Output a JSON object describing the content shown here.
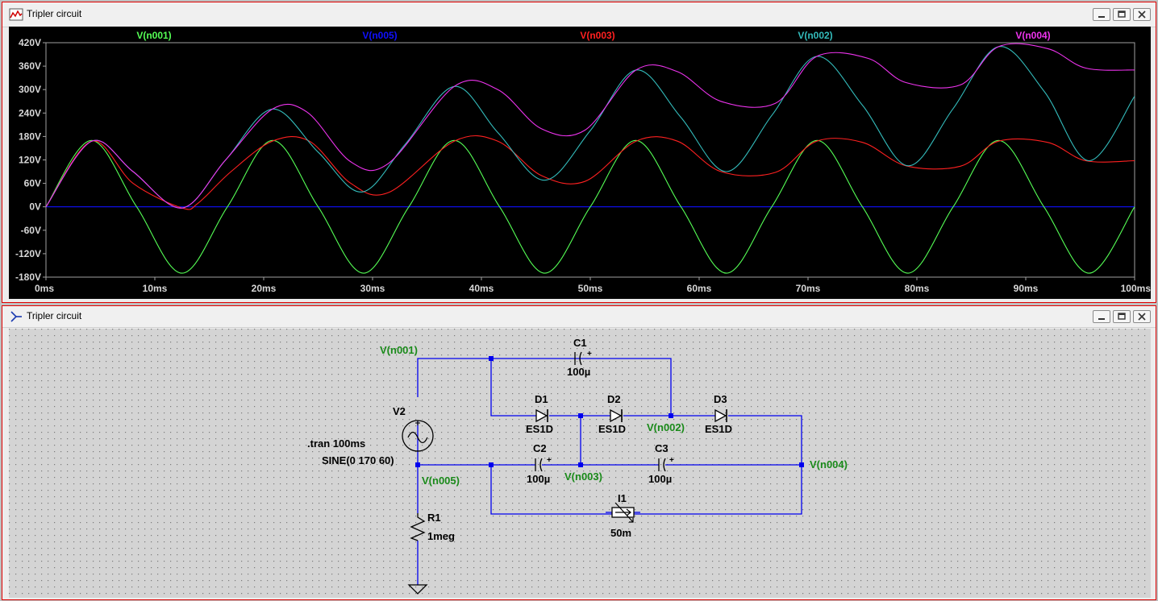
{
  "waveform_window": {
    "title": "Tripler circuit",
    "icon": "waveform-icon",
    "controls": [
      "minimize-icon",
      "restore-icon",
      "close-icon"
    ]
  },
  "schematic_window": {
    "title": "Tripler circuit",
    "icon": "schematic-icon",
    "controls": [
      "minimize-icon",
      "restore-icon",
      "close-icon"
    ]
  },
  "chart_data": {
    "type": "line",
    "xlabel": "",
    "ylabel": "",
    "xlim": [
      0,
      100
    ],
    "ylim": [
      -180,
      420
    ],
    "x_ticks": [
      "0ms",
      "10ms",
      "20ms",
      "30ms",
      "40ms",
      "50ms",
      "60ms",
      "70ms",
      "80ms",
      "90ms",
      "100ms"
    ],
    "y_ticks": [
      "420V",
      "360V",
      "300V",
      "240V",
      "180V",
      "120V",
      "60V",
      "0V",
      "-60V",
      "-120V",
      "-180V"
    ],
    "grid": false,
    "legend": "top",
    "x_unit": "ms",
    "series": [
      {
        "name": "V(n001)",
        "color": "#55ff55",
        "x": [
          0,
          4.17,
          8.33,
          12.5,
          16.67,
          20.83,
          25,
          29.17,
          33.33,
          37.5,
          41.67,
          45.83,
          50,
          54.17,
          58.33,
          62.5,
          66.67,
          70.83,
          75,
          79.17,
          83.33,
          87.5,
          91.67,
          95.83,
          100
        ],
        "y": [
          0,
          170,
          0,
          -170,
          0,
          170,
          0,
          -170,
          0,
          170,
          0,
          -170,
          0,
          170,
          0,
          -170,
          0,
          170,
          0,
          -170,
          0,
          170,
          0,
          -170,
          0
        ]
      },
      {
        "name": "V(n005)",
        "color": "#1010ff",
        "x": [
          0,
          100
        ],
        "y": [
          0,
          0
        ]
      },
      {
        "name": "V(n003)",
        "color": "#ff2020",
        "x": [
          0,
          4.2,
          8,
          12.5,
          14,
          17,
          20.8,
          24.2,
          28,
          31.5,
          37.5,
          41.5,
          45.5,
          49.5,
          54.2,
          58,
          62,
          67,
          70.8,
          75,
          79,
          84,
          87.5,
          92,
          95.5,
          100
        ],
        "y": [
          0,
          168,
          60,
          -3,
          10,
          90,
          168,
          168,
          60,
          37,
          168,
          168,
          80,
          65,
          168,
          168,
          90,
          88,
          168,
          165,
          105,
          104,
          168,
          165,
          118,
          118
        ]
      },
      {
        "name": "V(n002)",
        "color": "#33bbbb",
        "x": [
          0,
          4.2,
          8,
          12.5,
          16.5,
          20.8,
          25,
          29,
          33,
          37.5,
          41.5,
          45.8,
          50,
          54.2,
          58.3,
          62.5,
          66.7,
          70.8,
          75,
          79.2,
          83.3,
          87.5,
          91.7,
          95.8,
          100
        ],
        "y": [
          0,
          168,
          90,
          -3,
          120,
          250,
          140,
          38,
          160,
          308,
          190,
          68,
          195,
          350,
          230,
          90,
          235,
          385,
          260,
          105,
          250,
          410,
          295,
          118,
          283
        ]
      },
      {
        "name": "V(n004)",
        "color": "#ee33ee",
        "x": [
          0,
          4.2,
          8,
          12.5,
          16.5,
          20.8,
          24,
          28,
          31.5,
          37.5,
          41.5,
          45.5,
          49.5,
          54.2,
          58,
          62,
          67,
          70.8,
          75.5,
          79,
          84,
          87.5,
          92,
          95.5,
          100
        ],
        "y": [
          0,
          168,
          90,
          -3,
          120,
          250,
          242,
          115,
          112,
          308,
          300,
          200,
          196,
          350,
          346,
          270,
          265,
          385,
          380,
          318,
          312,
          410,
          405,
          355,
          350
        ]
      }
    ]
  },
  "schematic": {
    "net_labels": {
      "n001": "V(n001)",
      "n002": "V(n002)",
      "n003": "V(n003)",
      "n004": "V(n004)",
      "n005": "V(n005)"
    },
    "components": {
      "C1": {
        "name": "C1",
        "value": "100µ"
      },
      "C2": {
        "name": "C2",
        "value": "100µ"
      },
      "C3": {
        "name": "C3",
        "value": "100µ"
      },
      "D1": {
        "name": "D1",
        "value": "ES1D"
      },
      "D2": {
        "name": "D2",
        "value": "ES1D"
      },
      "D3": {
        "name": "D3",
        "value": "ES1D"
      },
      "V2": {
        "name": "V2",
        "value": "SINE(0 170 60)"
      },
      "R1": {
        "name": "R1",
        "value": "1meg"
      },
      "I1": {
        "name": "I1",
        "value": "50m"
      }
    },
    "directive": ".tran 100ms",
    "wire_color": "#0000ee",
    "label_color": "#1a8a1a",
    "grid_dot_color": "#7a7a7a"
  }
}
